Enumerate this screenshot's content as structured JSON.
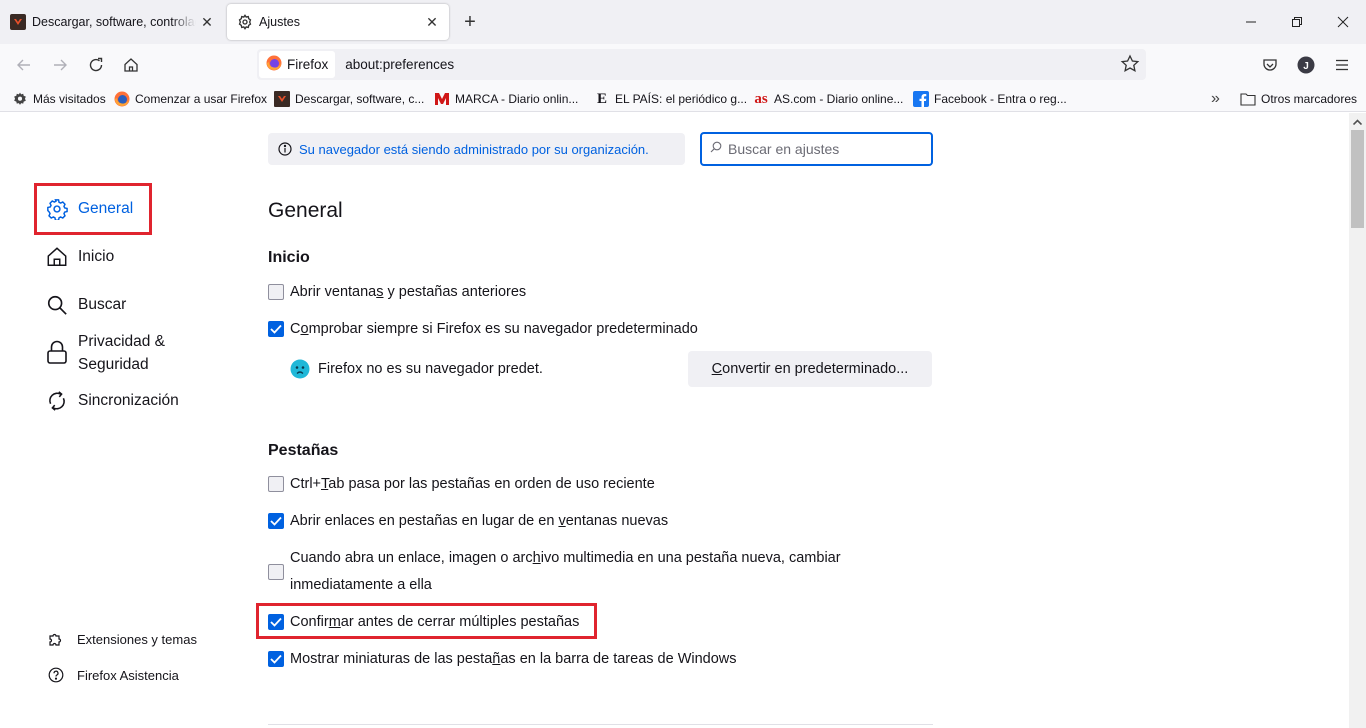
{
  "window": {
    "tabs": [
      {
        "title": "Descargar, software, controladores",
        "icon": "softonic-favicon",
        "active": false
      },
      {
        "title": "Ajustes",
        "icon": "gear-icon",
        "active": true
      }
    ],
    "new_tab_label": "+",
    "controls": [
      "minimize",
      "restore",
      "close"
    ]
  },
  "navbar": {
    "identity_label": "Firefox",
    "url": "about:preferences"
  },
  "bookmarks": {
    "items": [
      {
        "label": "Más visitados",
        "icon": "gear-icon"
      },
      {
        "label": "Comenzar a usar Firefox",
        "icon": "firefox-icon"
      },
      {
        "label": "Descargar, software, c...",
        "icon": "softonic-favicon"
      },
      {
        "label": "MARCA - Diario onlin...",
        "icon": "marca-favicon"
      },
      {
        "label": "EL PAÍS: el periódico g...",
        "icon": "elpais-favicon"
      },
      {
        "label": "AS.com - Diario online...",
        "icon": "as-favicon"
      },
      {
        "label": "Facebook - Entra o reg...",
        "icon": "facebook-favicon"
      }
    ],
    "overflow_label": "»",
    "other_label": "Otros marcadores"
  },
  "sidebar": {
    "items": [
      {
        "label": "General",
        "icon": "gear-icon",
        "active": true
      },
      {
        "label": "Inicio",
        "icon": "home-icon"
      },
      {
        "label": "Buscar",
        "icon": "search-icon"
      },
      {
        "label_line1": "Privacidad &",
        "label_line2": "Seguridad",
        "icon": "lock-icon"
      },
      {
        "label": "Sincronización",
        "icon": "sync-icon"
      }
    ],
    "footer": [
      {
        "label": "Extensiones y temas",
        "icon": "puzzle-icon"
      },
      {
        "label": "Firefox Asistencia",
        "icon": "help-icon"
      }
    ]
  },
  "main": {
    "notice": "Su navegador está siendo administrado por su organización.",
    "search_placeholder": "Buscar en ajustes",
    "title": "General",
    "sections": {
      "inicio": {
        "heading": "Inicio",
        "options": [
          {
            "pre": "Abrir ventana",
            "key": "s",
            "post": " y pestañas anteriores",
            "checked": false
          },
          {
            "pre": "C",
            "key": "o",
            "post": "mprobar siempre si Firefox es su navegador predeterminado",
            "checked": true
          }
        ],
        "not_default_text": "Firefox no es su navegador predet.",
        "make_default_button": {
          "key": "C",
          "rest": "onvertir en predeterminado..."
        }
      },
      "pestanas": {
        "heading": "Pestañas",
        "options": [
          {
            "pre": "Ctrl+",
            "key": "T",
            "post": "ab pasa por las pestañas en orden de uso reciente",
            "checked": false
          },
          {
            "pre": "Abrir enlaces en pestañas en lugar de en ",
            "key": "v",
            "post": "entanas nuevas",
            "checked": true
          },
          {
            "line1_pre": "Cuando abra un enlace, imagen o arc",
            "line1_key": "h",
            "line1_post": "ivo multimedia en una pestaña nueva, cambiar",
            "line2": "inmediatamente a ella",
            "checked": false
          },
          {
            "pre": "Confir",
            "key": "m",
            "post": "ar antes de cerrar múltiples pestañas",
            "checked": true
          },
          {
            "pre": "Mostrar miniaturas de las pesta",
            "key": "ñ",
            "post": "as en la barra de tareas de Windows",
            "checked": true
          }
        ]
      }
    }
  },
  "colors": {
    "accent": "#0061e0",
    "highlight": "#e0242e",
    "tabbar": "#f0f0f4"
  }
}
